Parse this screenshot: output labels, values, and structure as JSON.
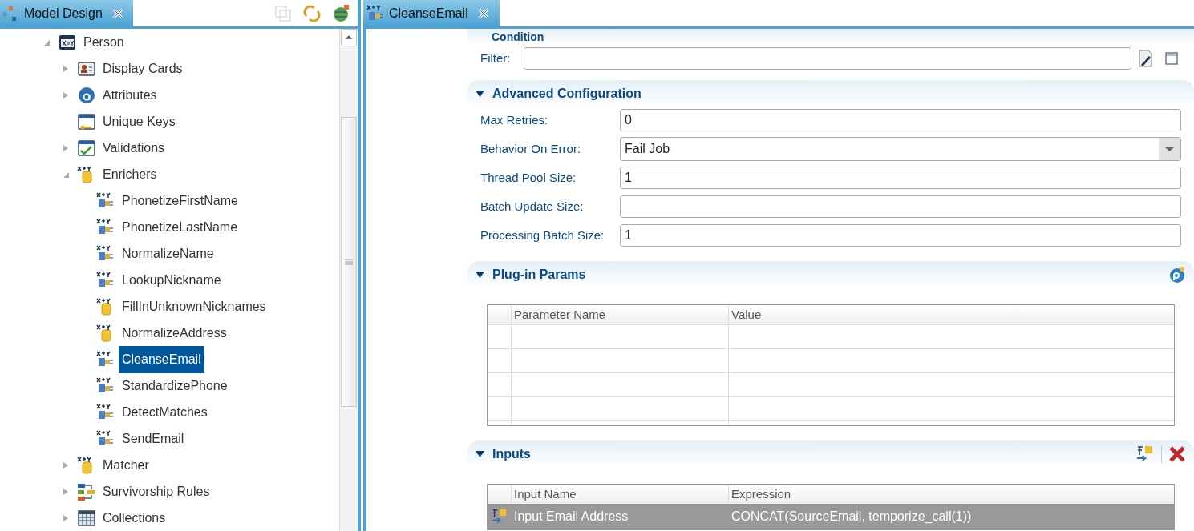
{
  "left_tab": {
    "title": "Model Design",
    "selected": true
  },
  "tree": [
    {
      "label": "Person",
      "kind": "entity",
      "expanded": true,
      "selected": false,
      "children": [
        {
          "label": "Display Cards",
          "kind": "cards",
          "expanded": false,
          "selected": false
        },
        {
          "label": "Attributes",
          "kind": "attributes",
          "expanded": false,
          "selected": false
        },
        {
          "label": "Unique Keys",
          "kind": "keys",
          "selected": false
        },
        {
          "label": "Validations",
          "kind": "validations",
          "expanded": false,
          "selected": false
        },
        {
          "label": "Enrichers",
          "kind": "rule",
          "expanded": true,
          "selected": false,
          "children": [
            {
              "label": "PhonetizeFirstName",
              "kind": "plugin",
              "selected": false
            },
            {
              "label": "PhonetizeLastName",
              "kind": "plugin",
              "selected": false
            },
            {
              "label": "NormalizeName",
              "kind": "plugin",
              "selected": false
            },
            {
              "label": "LookupNickname",
              "kind": "plugin",
              "selected": false
            },
            {
              "label": "FillInUnknownNicknames",
              "kind": "rule",
              "selected": false
            },
            {
              "label": "NormalizeAddress",
              "kind": "rule",
              "selected": false
            },
            {
              "label": "CleanseEmail",
              "kind": "plugin",
              "selected": true
            },
            {
              "label": "StandardizePhone",
              "kind": "plugin",
              "selected": false
            },
            {
              "label": "DetectMatches",
              "kind": "plugin",
              "selected": false
            },
            {
              "label": "SendEmail",
              "kind": "plugin",
              "selected": false
            }
          ]
        },
        {
          "label": "Matcher",
          "kind": "rule",
          "expanded": false,
          "selected": false
        },
        {
          "label": "Survivorship Rules",
          "kind": "survivorship",
          "expanded": false,
          "selected": false
        },
        {
          "label": "Collections",
          "kind": "collections",
          "expanded": false,
          "selected": false
        }
      ]
    }
  ],
  "editor_tab": {
    "title": "CleanseEmail",
    "selected": true
  },
  "condition": {
    "title": "Condition",
    "filter_label": "Filter:"
  },
  "advanced": {
    "title": "Advanced Configuration",
    "expanded": true,
    "fields": [
      {
        "label": "Max Retries:",
        "kind": "text",
        "value": "0"
      },
      {
        "label": "Behavior On Error:",
        "kind": "select",
        "value": "Fail Job"
      },
      {
        "label": "Thread Pool Size:",
        "kind": "text",
        "value": "1"
      },
      {
        "label": "Batch Update Size:",
        "kind": "text"
      },
      {
        "label": "Processing Batch Size:",
        "kind": "text",
        "value": "1"
      }
    ]
  },
  "plugin_params": {
    "title": "Plug-in Params",
    "expanded": true,
    "columns": [
      "Parameter Name",
      "Value"
    ]
  },
  "inputs": {
    "title": "Inputs",
    "expanded": true,
    "columns": [
      "Input Name",
      "Expression"
    ],
    "rows": [
      {
        "name": "Input Email Address",
        "expression": "CONCAT(SourceEmail, temporize_call(1))",
        "selected": true
      }
    ]
  }
}
